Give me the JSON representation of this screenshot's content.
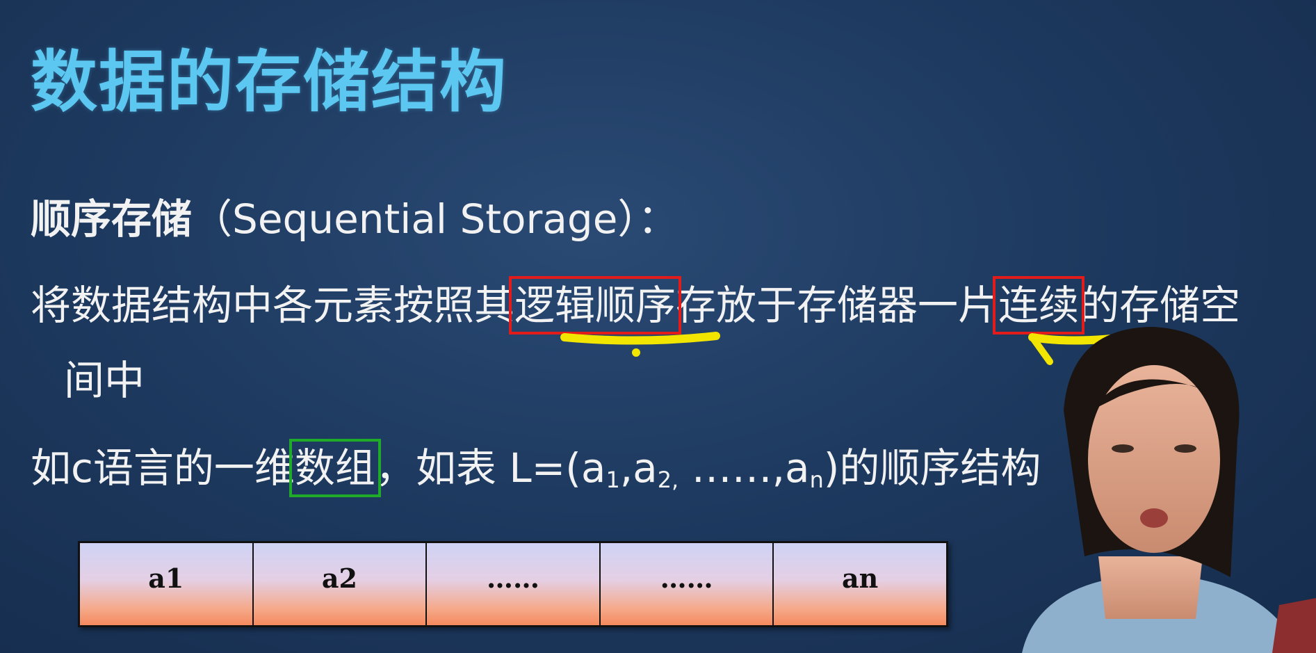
{
  "slide": {
    "title": "数据的存储结构",
    "heading_cn": "顺序存储",
    "heading_en": "（Sequential Storage）：",
    "line1_a": "将数据结构中各元素按照其",
    "line1_b": "逻辑顺序",
    "line1_c": "存放于存储器一片",
    "line1_d": "连续",
    "line1_e": "的存储空",
    "line2": "间中",
    "line3_a": "如c语言的一维",
    "line3_b": "数组",
    "line3_c": "，如表 L=(a",
    "line3_sub1": "1",
    "line3_d": ",a",
    "line3_sub2": "2,",
    "line3_e": " ……,a",
    "line3_sub3": "n",
    "line3_f": ")的顺序结构",
    "cells": [
      "a1",
      "a2",
      "……",
      "……",
      "an"
    ]
  }
}
